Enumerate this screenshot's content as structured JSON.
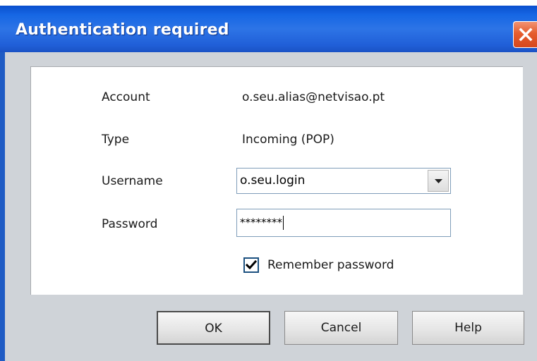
{
  "window": {
    "title": "Authentication required"
  },
  "form": {
    "account_label": "Account",
    "account_value": "o.seu.alias@netvisao.pt",
    "type_label": "Type",
    "type_value": "Incoming (POP)",
    "username_label": "Username",
    "username_value": "o.seu.login",
    "password_label": "Password",
    "password_value": "********",
    "remember_label": "Remember password",
    "remember_checked": true
  },
  "buttons": {
    "ok": "OK",
    "cancel": "Cancel",
    "help": "Help"
  },
  "icons": {
    "close": "close-icon",
    "dropdown": "chevron-down-icon",
    "check": "checkmark-icon"
  },
  "colors": {
    "titlebar": "#2d74e6",
    "close_button": "#e55d2e",
    "dialog_body": "#cfd3d8"
  }
}
